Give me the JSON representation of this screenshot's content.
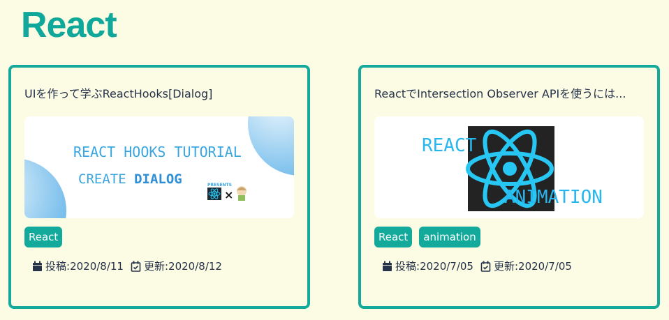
{
  "section": {
    "title": "React"
  },
  "cards": [
    {
      "title": "UIを作って学ぶReactHooks[Dialog]",
      "thumbnail": {
        "line1": "REACT HOOKS TUTORIAL",
        "line2a": "CREATE ",
        "line2b": "DIALOG",
        "presents": "PRESENTS",
        "times": "×"
      },
      "tags": [
        "React"
      ],
      "posted_label": "投稿:",
      "posted": "2020/8/11",
      "updated_label": "更新:",
      "updated": "2020/8/12"
    },
    {
      "title": "ReactでIntersection Observer APIを使うには...",
      "thumbnail": {
        "line1": "REACT",
        "line2": "ANIMATION"
      },
      "tags": [
        "React",
        "animation"
      ],
      "posted_label": "投稿:",
      "posted": "2020/7/05",
      "updated_label": "更新:",
      "updated": "2020/7/05"
    }
  ],
  "icons": {
    "posted": "calendar-icon",
    "updated": "calendar-check-icon"
  },
  "colors": {
    "accent": "#13a99b",
    "background": "#fcfce4",
    "thumb_text": "#3aa6e0",
    "react_cyan": "#28c6f2"
  }
}
